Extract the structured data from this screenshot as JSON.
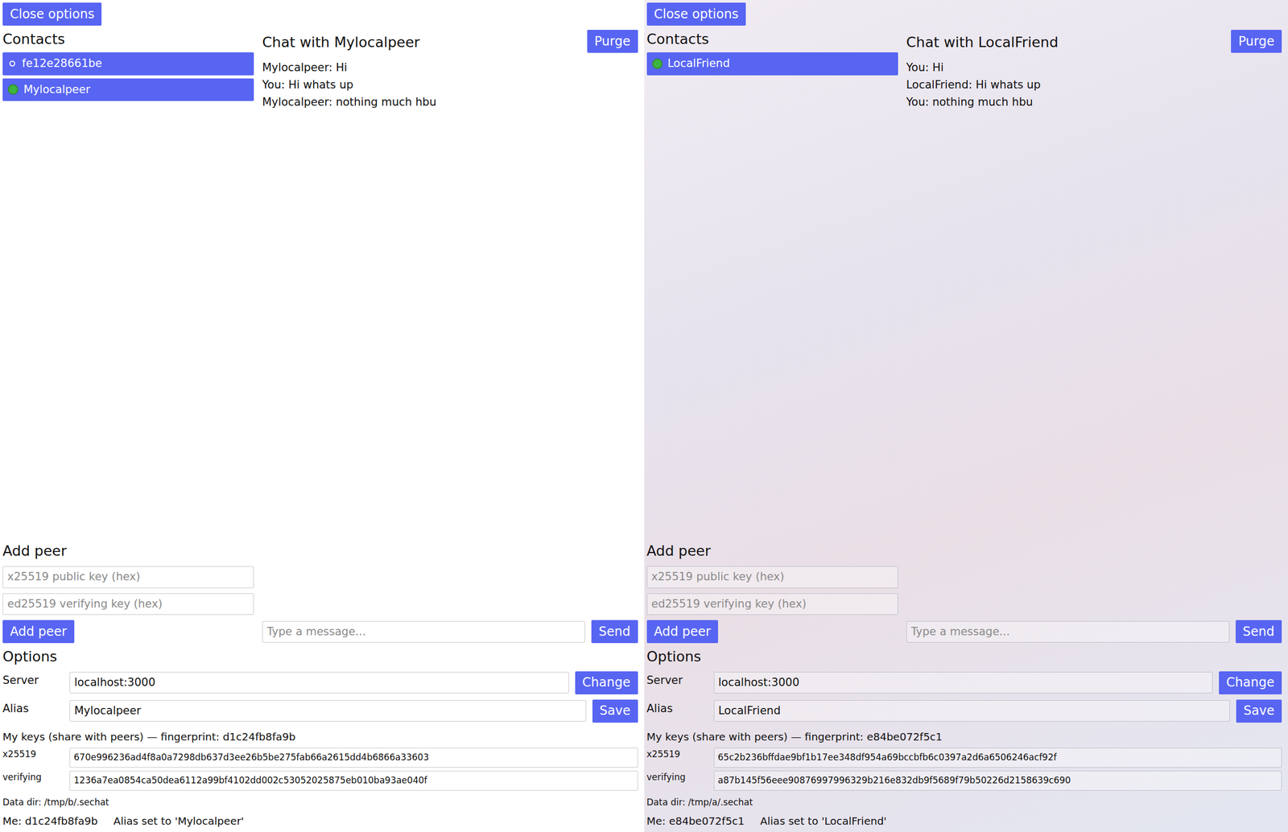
{
  "panes": [
    {
      "kind": "plain",
      "close_button": "Close options",
      "contacts_title": "Contacts",
      "contacts": [
        {
          "label": "fe12e28661be",
          "online": false
        },
        {
          "label": "Mylocalpeer",
          "online": true
        }
      ],
      "chat_title": "Chat with Mylocalpeer",
      "purge_button": "Purge",
      "messages": [
        "Mylocalpeer: Hi",
        "You: Hi whats up",
        "Mylocalpeer: nothing much hbu"
      ],
      "add_peer": {
        "title": "Add peer",
        "x25519_placeholder": "x25519 public key (hex)",
        "verifying_placeholder": "ed25519 verifying key (hex)",
        "button": "Add peer"
      },
      "composer": {
        "placeholder": "Type a message...",
        "button": "Send"
      },
      "options": {
        "title": "Options",
        "server_label": "Server",
        "server_value": "localhost:3000",
        "server_button": "Change",
        "alias_label": "Alias",
        "alias_value": "Mylocalpeer",
        "alias_button": "Save",
        "keys_title": "My keys (share with peers) — fingerprint: d1c24fb8fa9b",
        "x25519_label": "x25519",
        "x25519_value": "670e996236ad4f8a0a7298db637d3ee26b5be275fab66a2615dd4b6866a33603",
        "verifying_label": "verifying",
        "verifying_value": "1236a7ea0854ca50dea6112a99bf4102dd002c53052025875eb010ba93ae040f",
        "data_dir": "Data dir: /tmp/b/.sechat"
      },
      "status": {
        "me": "Me: d1c24fb8fa9b",
        "message": "Alias set to 'Mylocalpeer'"
      }
    },
    {
      "kind": "photo",
      "close_button": "Close options",
      "contacts_title": "Contacts",
      "contacts": [
        {
          "label": "LocalFriend",
          "online": true
        }
      ],
      "chat_title": "Chat with LocalFriend",
      "purge_button": "Purge",
      "messages": [
        "You: Hi",
        "LocalFriend: Hi whats up",
        "You: nothing much hbu"
      ],
      "add_peer": {
        "title": "Add peer",
        "x25519_placeholder": "x25519 public key (hex)",
        "verifying_placeholder": "ed25519 verifying key (hex)",
        "button": "Add peer"
      },
      "composer": {
        "placeholder": "Type a message...",
        "button": "Send"
      },
      "options": {
        "title": "Options",
        "server_label": "Server",
        "server_value": "localhost:3000",
        "server_button": "Change",
        "alias_label": "Alias",
        "alias_value": "LocalFriend",
        "alias_button": "Save",
        "keys_title": "My keys (share with peers) — fingerprint: e84be072f5c1",
        "x25519_label": "x25519",
        "x25519_value": "65c2b236bffdae9bf1b17ee348df954a69bccbfb6c0397a2d6a6506246acf92f",
        "verifying_label": "verifying",
        "verifying_value": "a87b145f56eee90876997996329b216e832db9f5689f79b50226d2158639c690",
        "data_dir": "Data dir: /tmp/a/.sechat"
      },
      "status": {
        "me": "Me: e84be072f5c1",
        "message": "Alias set to 'LocalFriend'"
      }
    }
  ]
}
